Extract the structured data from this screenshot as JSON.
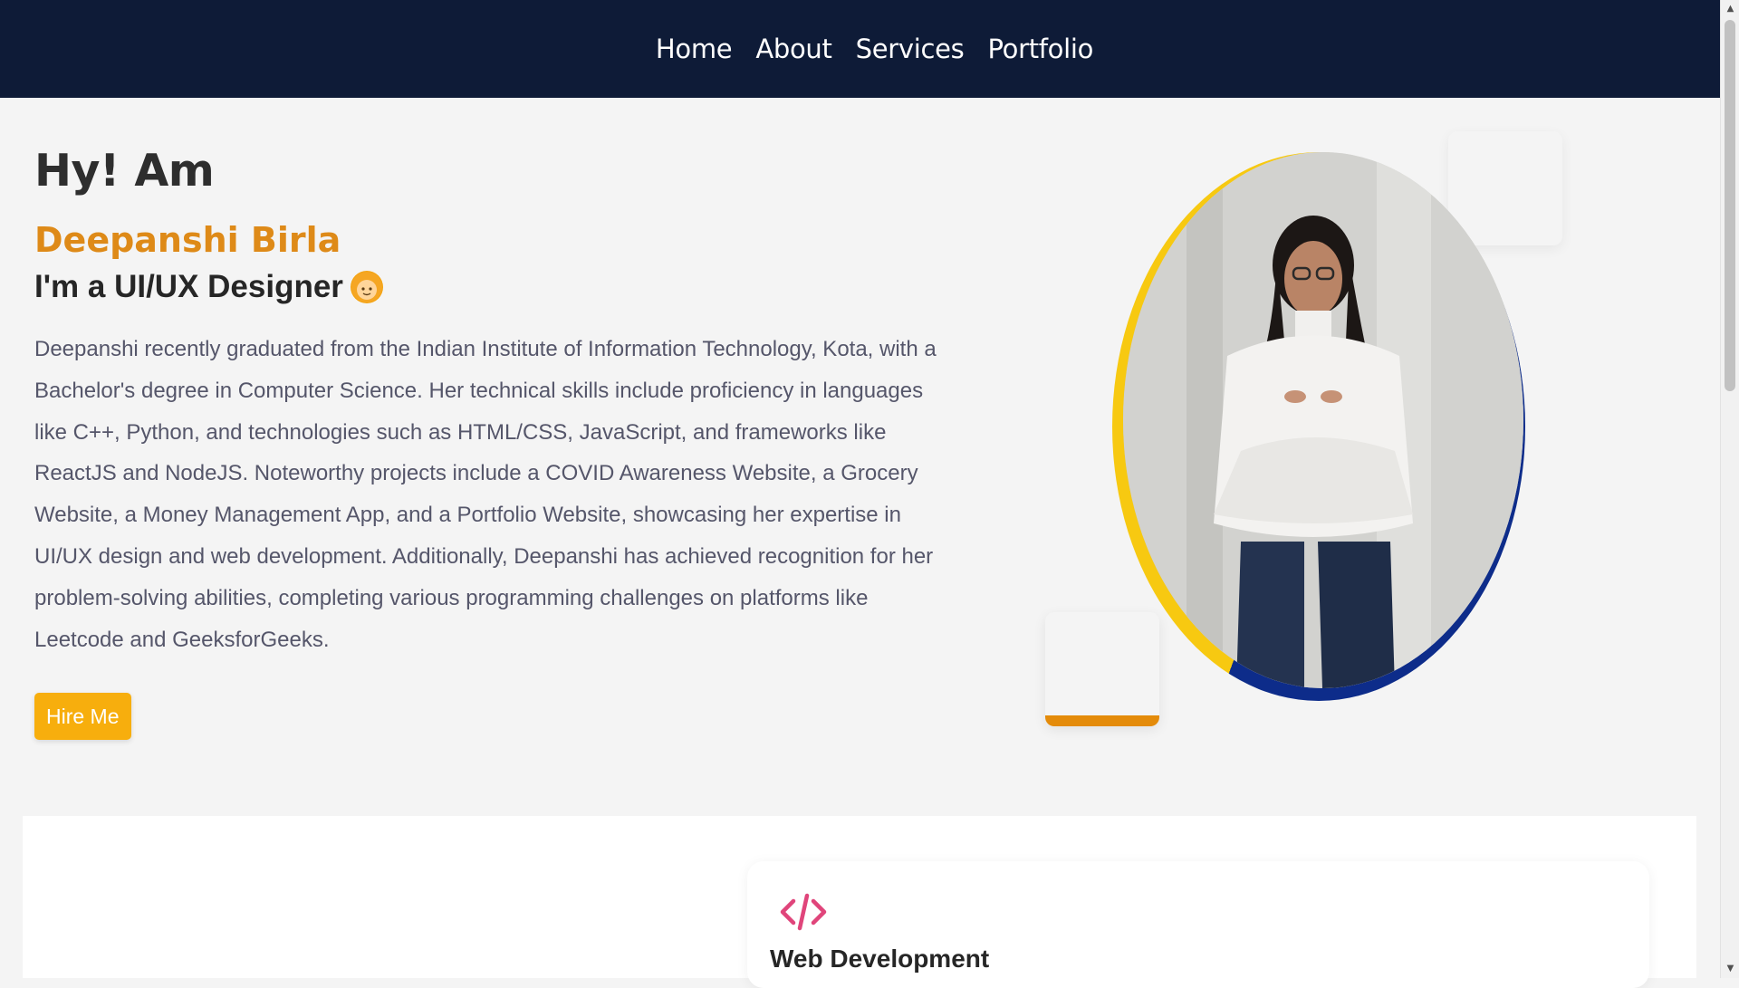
{
  "nav": {
    "items": [
      {
        "label": "Home"
      },
      {
        "label": "About"
      },
      {
        "label": "Services"
      },
      {
        "label": "Portfolio"
      }
    ]
  },
  "hero": {
    "greeting": "Hy! Am",
    "name": "Deepanshi Birla",
    "role": "I'm a UI/UX Designer",
    "bio": "Deepanshi recently graduated from the Indian Institute of Information Technology, Kota, with a Bachelor's degree in Computer Science. Her technical skills include proficiency in languages like C++, Python, and technologies such as HTML/CSS, JavaScript, and frameworks like ReactJS and NodeJS. Noteworthy projects include a COVID Awareness Website, a Grocery Website, a Money Management App, and a Portfolio Website, showcasing her expertise in UI/UX design and web development. Additionally, Deepanshi has achieved recognition for her problem-solving abilities, completing various programming challenges on platforms like Leetcode and GeeksforGeeks.",
    "cta_label": "Hire Me"
  },
  "services": {
    "cards": [
      {
        "icon": "code-icon",
        "title": "Web Development"
      }
    ]
  },
  "colors": {
    "nav_bg": "#0e1b37",
    "name_accent": "#de8a18",
    "button": "#f7ae0d",
    "ring_blue": "#0d2c8a",
    "ring_yellow": "#f7c911",
    "icon_pink": "#e0457b"
  }
}
